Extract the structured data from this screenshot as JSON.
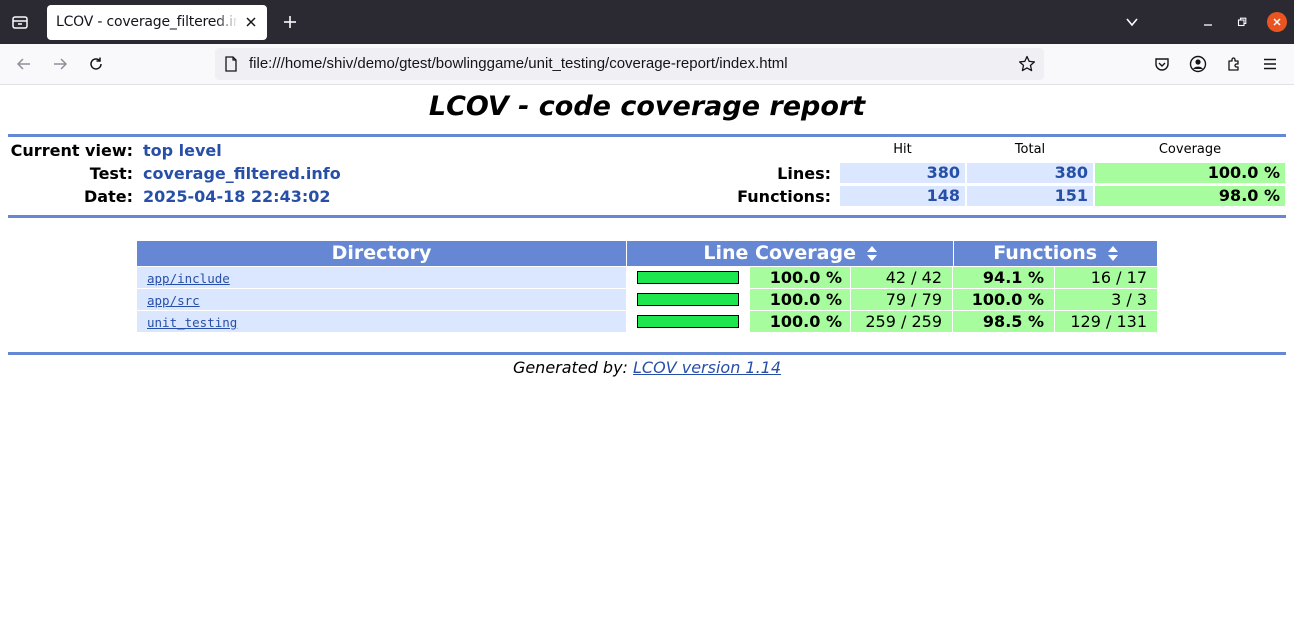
{
  "browser": {
    "tab_title": "LCOV - coverage_filtered.info",
    "url": "file:///home/shiv/demo/gtest/bowlinggame/unit_testing/coverage-report/index.html",
    "colors": {
      "tabbar": "#2b2a33",
      "close_button": "#e95420"
    }
  },
  "report": {
    "title": "LCOV - code coverage report",
    "header": {
      "current_view_label": "Current view:",
      "current_view_value": "top level",
      "test_label": "Test:",
      "test_value": "coverage_filtered.info",
      "date_label": "Date:",
      "date_value": "2025-04-18 22:43:02",
      "col_hit": "Hit",
      "col_total": "Total",
      "col_coverage": "Coverage",
      "lines_label": "Lines:",
      "lines_hit": "380",
      "lines_total": "380",
      "lines_coverage": "100.0 %",
      "functions_label": "Functions:",
      "functions_hit": "148",
      "functions_total": "151",
      "functions_coverage": "98.0 %"
    },
    "table": {
      "col_directory": "Directory",
      "col_line_coverage": "Line Coverage",
      "col_functions": "Functions",
      "rows": [
        {
          "name": "app/include",
          "bar_fraction": 1.0,
          "line_pct": "100.0 %",
          "line_count": "42 / 42",
          "func_pct": "94.1 %",
          "func_count": "16 / 17"
        },
        {
          "name": "app/src",
          "bar_fraction": 1.0,
          "line_pct": "100.0 %",
          "line_count": "79 / 79",
          "func_pct": "100.0 %",
          "func_count": "3 / 3"
        },
        {
          "name": "unit_testing",
          "bar_fraction": 1.0,
          "line_pct": "100.0 %",
          "line_count": "259 / 259",
          "func_pct": "98.5 %",
          "func_count": "129 / 131"
        }
      ]
    },
    "footer": {
      "prefix": "Generated by:",
      "link": "LCOV version 1.14"
    },
    "colors": {
      "header_blue": "#6688d4",
      "value_blue": "#284fa8",
      "cell_blue": "#dae7fe",
      "cell_green": "#a7fc9d",
      "bar_green": "#1ee64e"
    }
  }
}
